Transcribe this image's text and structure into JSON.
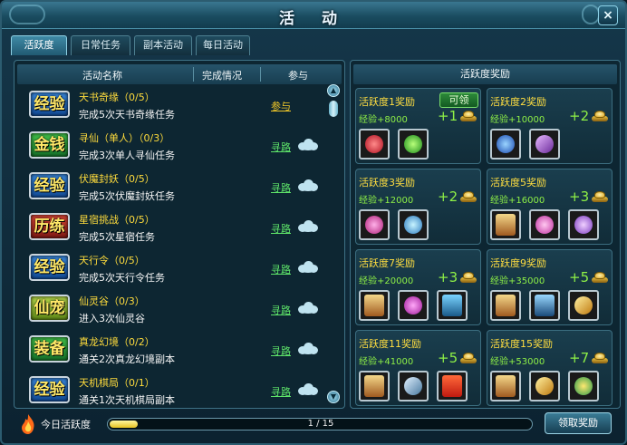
{
  "window": {
    "title": "活 动",
    "close_glyph": "×"
  },
  "tabs": [
    {
      "label": "活跃度",
      "active": true
    },
    {
      "label": "日常任务",
      "active": false
    },
    {
      "label": "副本活动",
      "active": false
    },
    {
      "label": "每日活动",
      "active": false
    }
  ],
  "activity_list": {
    "headers": {
      "name": "活动名称",
      "status": "完成情况",
      "join": "参与"
    },
    "rows": [
      {
        "badge": "经验",
        "badge_color": "blue",
        "name": "天书奇缘（0/5）",
        "desc": "完成5次天书奇缘任务",
        "link": "参与",
        "link_type": "join"
      },
      {
        "badge": "金钱",
        "badge_color": "green",
        "name": "寻仙（单人）（0/3）",
        "desc": "完成3次单人寻仙任务",
        "link": "寻路",
        "link_type": "path"
      },
      {
        "badge": "经验",
        "badge_color": "blue",
        "name": "伏魔封妖（0/5）",
        "desc": "完成5次伏魔封妖任务",
        "link": "寻路",
        "link_type": "path"
      },
      {
        "badge": "历练",
        "badge_color": "red",
        "name": "星宿挑战（0/5）",
        "desc": "完成5次星宿任务",
        "link": "寻路",
        "link_type": "path"
      },
      {
        "badge": "经验",
        "badge_color": "blue",
        "name": "天行令（0/5）",
        "desc": "完成5次天行令任务",
        "link": "寻路",
        "link_type": "path"
      },
      {
        "badge": "仙宠",
        "badge_color": "lime",
        "name": "仙灵谷（0/3）",
        "desc": "进入3次仙灵谷",
        "link": "寻路",
        "link_type": "path"
      },
      {
        "badge": "装备",
        "badge_color": "green",
        "name": "真龙幻境（0/2）",
        "desc": "通关2次真龙幻境副本",
        "link": "寻路",
        "link_type": "path"
      },
      {
        "badge": "经验",
        "badge_color": "blue",
        "name": "天机棋局（0/1）",
        "desc": "通关1次天机棋局副本",
        "link": "寻路",
        "link_type": "path"
      }
    ]
  },
  "rewards": {
    "header": "活跃度奖励",
    "claim_label": "可领",
    "cards": [
      {
        "title": "活跃度1奖励",
        "exp": "经验+8000",
        "gold": "+1",
        "claimable": true,
        "items": [
          "red-potion-icon",
          "green-gem-icon"
        ]
      },
      {
        "title": "活跃度2奖励",
        "exp": "经验+10000",
        "gold": "+2",
        "claimable": false,
        "items": [
          "blue-potion-icon",
          "purple-crystal-icon"
        ]
      },
      {
        "title": "活跃度3奖励",
        "exp": "经验+12000",
        "gold": "+2",
        "claimable": false,
        "items": [
          "pink-potion-icon",
          "blue-gem-icon"
        ]
      },
      {
        "title": "活跃度5奖励",
        "exp": "经验+16000",
        "gold": "+3",
        "claimable": false,
        "items": [
          "scroll-icon",
          "pink-orb-icon",
          "purple-swirl-icon"
        ]
      },
      {
        "title": "活跃度7奖励",
        "exp": "经验+20000",
        "gold": "+3",
        "claimable": false,
        "items": [
          "scroll-icon",
          "magenta-gem-icon",
          "star-card-icon"
        ]
      },
      {
        "title": "活跃度9奖励",
        "exp": "经验+35000",
        "gold": "+5",
        "claimable": false,
        "items": [
          "scroll-icon",
          "blue-star-card-icon",
          "golden-key-icon"
        ]
      },
      {
        "title": "活跃度11奖励",
        "exp": "经验+41000",
        "gold": "+5",
        "claimable": false,
        "items": [
          "scroll-icon",
          "sword-icon",
          "gift-box-icon"
        ]
      },
      {
        "title": "活跃度15奖励",
        "exp": "经验+53000",
        "gold": "+7",
        "claimable": false,
        "items": [
          "scroll-icon",
          "golden-key-icon",
          "colorful-orbs-icon"
        ]
      }
    ]
  },
  "bottom": {
    "label": "今日活跃度",
    "progress_text": "1 / 15",
    "progress_value": 1,
    "progress_max": 15,
    "claim_button": "领取奖励"
  },
  "colors": {
    "accent": "#ffde40",
    "exp": "#8ef046",
    "link_join": "#f2c928",
    "link_path": "#5fe66a"
  }
}
